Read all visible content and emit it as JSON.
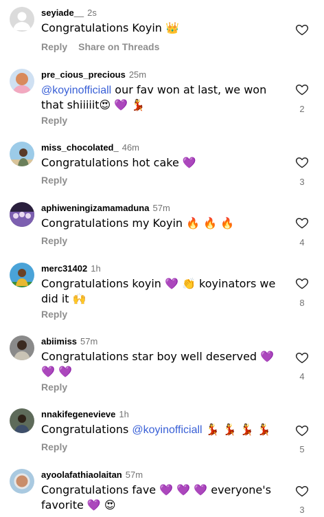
{
  "actions": {
    "reply_label": "Reply",
    "share_threads_label": "Share on Threads"
  },
  "comments": [
    {
      "username": "seyiade__",
      "time": "2s",
      "text": "Congratulations Koyin 👑",
      "like_count": "",
      "avatar": "default-avatar"
    },
    {
      "username": "pre_cious_precious",
      "time": "25m",
      "mention": "@koyinofficiall",
      "text": " our fav won at last, we won that shiiiiit😍 💜 💃",
      "like_count": "2",
      "avatar": "user-avatar"
    },
    {
      "username": "miss_chocolated_",
      "time": "46m",
      "text": "Congratulations hot cake 💜",
      "like_count": "3",
      "avatar": "user-avatar"
    },
    {
      "username": "aphiweningizamamaduna",
      "time": "57m",
      "text": "Congratulations my Koyin 🔥 🔥 🔥",
      "like_count": "4",
      "avatar": "user-avatar"
    },
    {
      "username": "merc31402",
      "time": "1h",
      "text": "Congratulations koyin 💜 👏 koyinators we did it 🙌",
      "like_count": "8",
      "avatar": "user-avatar"
    },
    {
      "username": "abiimiss",
      "time": "57m",
      "text": "Congratulations star boy well deserved 💜 💜 💜",
      "like_count": "4",
      "avatar": "user-avatar"
    },
    {
      "username": "nnakifegenevieve",
      "time": "1h",
      "text_before": "Congratulations ",
      "mention": "@koyinofficiall",
      "text": " 💃 💃 💃 💃",
      "like_count": "5",
      "avatar": "user-avatar"
    },
    {
      "username": "ayoolafathiaolaitan",
      "time": "57m",
      "text": "Congratulations fave 💜 💜 💜 everyone's favorite 💜 😍",
      "like_count": "3",
      "avatar": "user-avatar"
    }
  ],
  "colors": {
    "username": "#000000",
    "meta": "#737373",
    "mention": "#385fd6",
    "action": "#8e8e8e"
  },
  "icons": {
    "like": "heart-outline-icon",
    "avatar": "avatar-icon"
  }
}
